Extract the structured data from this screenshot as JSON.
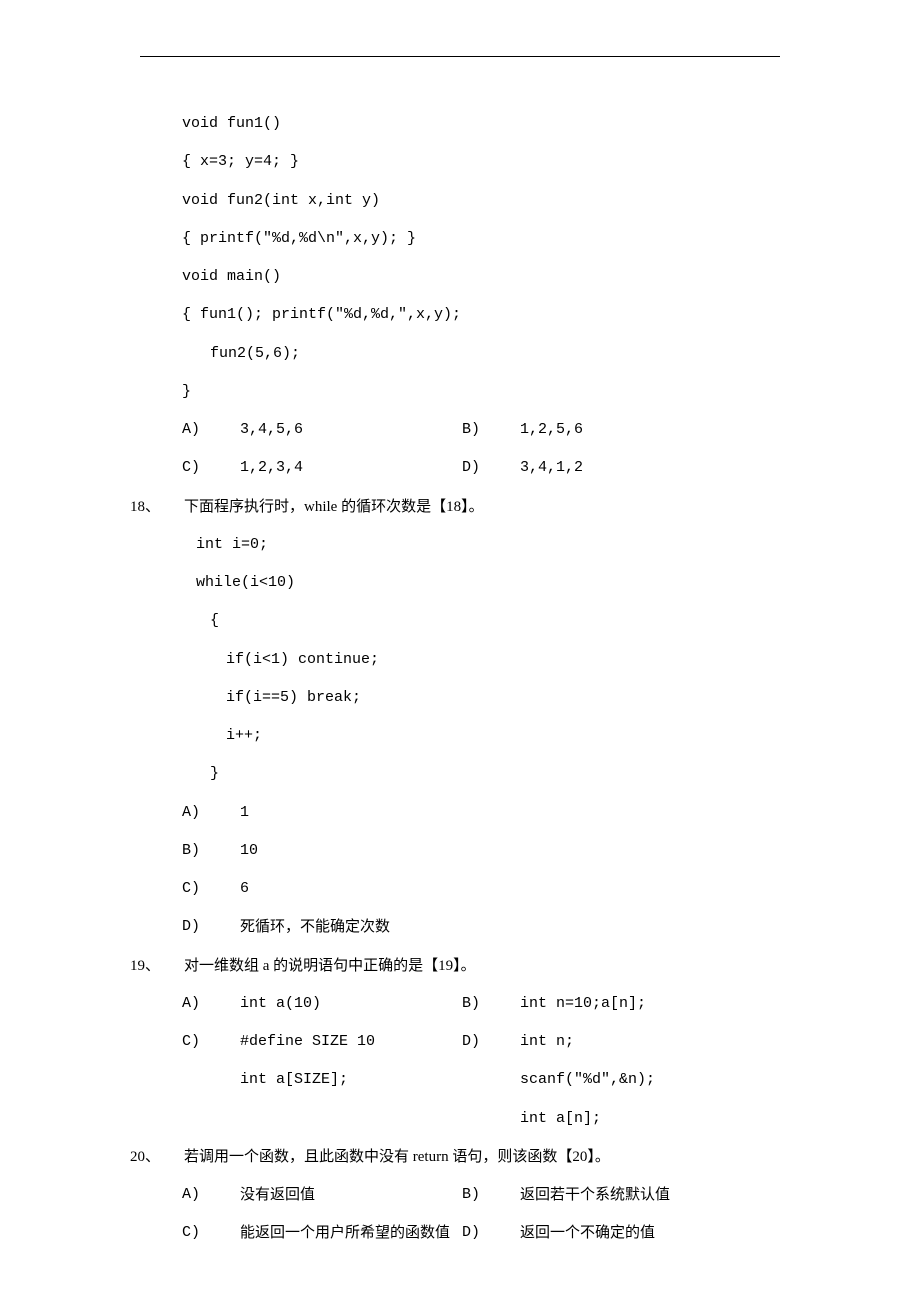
{
  "q17": {
    "code": [
      "void fun1()",
      "{  x=3; y=4; }",
      "void fun2(int x,int y)",
      "{  printf(\"%d,%d\\n\",x,y); }",
      "void main()",
      "{  fun1(); printf(\"%d,%d,\",x,y);"
    ],
    "code_ind": "fun2(5,6);",
    "code_close": "}",
    "opts": {
      "A": "3,4,5,6",
      "B": "1,2,5,6",
      "C": "1,2,3,4",
      "D": "3,4,1,2"
    }
  },
  "q18": {
    "num": "18、",
    "text": "下面程序执行时，while 的循环次数是【18】。",
    "code": {
      "l1": "int  i=0;",
      "l2": "while(i<10)",
      "l3": "{",
      "l4": "if(i<1) continue;",
      "l5": "if(i==5) break;",
      "l6": "i++;",
      "l7": "}"
    },
    "opts": {
      "A": "1",
      "B": "10",
      "C": "6",
      "D": "死循环，不能确定次数"
    }
  },
  "q19": {
    "num": "19、",
    "text": "对一维数组 a 的说明语句中正确的是【19】。",
    "A": "int a(10)",
    "B": "int n=10;a[n];",
    "C1": "#define SIZE 10",
    "C2": "int a[SIZE];",
    "D1": "int n;",
    "D2": "scanf(\"%d\",&n);",
    "D3": "int a[n];"
  },
  "q20": {
    "num": "20、",
    "text": "若调用一个函数，且此函数中没有 return 语句，则该函数【20】。",
    "opts": {
      "A": "没有返回值",
      "B": "返回若干个系统默认值",
      "C": "能返回一个用户所希望的函数值",
      "D": "返回一个不确定的值"
    }
  },
  "labels": {
    "A": "A)",
    "B": "B)",
    "C": "C)",
    "D": "D)"
  }
}
